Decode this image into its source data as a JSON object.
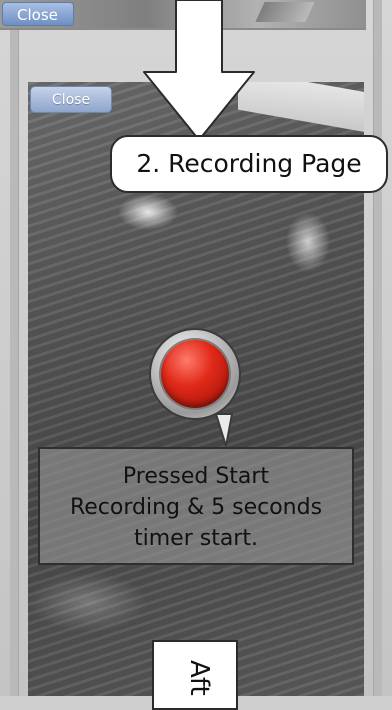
{
  "top_strip": {
    "close_label": "Close"
  },
  "screen": {
    "close_label": "Close"
  },
  "callout": {
    "title": "2. Recording Page"
  },
  "record_button": {
    "color": "#d9251a"
  },
  "info_box": {
    "lines": [
      "Pressed  Start",
      "Recording & 5 seconds",
      "timer start."
    ]
  },
  "next_step": {
    "label": "Aft"
  }
}
